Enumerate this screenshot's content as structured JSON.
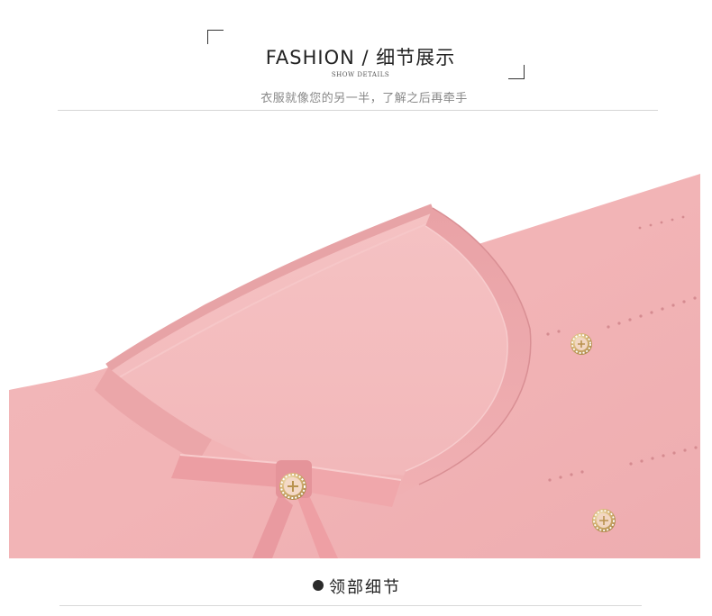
{
  "header": {
    "title": "FASHION / 细节展示",
    "subtitle": "SHOW DETAILS",
    "tagline": "衣服就像您的另一半，了解之后再牵手"
  },
  "colors": {
    "knit_pink": "#f0b1b4",
    "knit_shadow": "#df9a9d",
    "gold": "#c9a660",
    "text_dark": "#222222",
    "text_grey": "#888888"
  },
  "caption": {
    "label": "领部细节"
  }
}
